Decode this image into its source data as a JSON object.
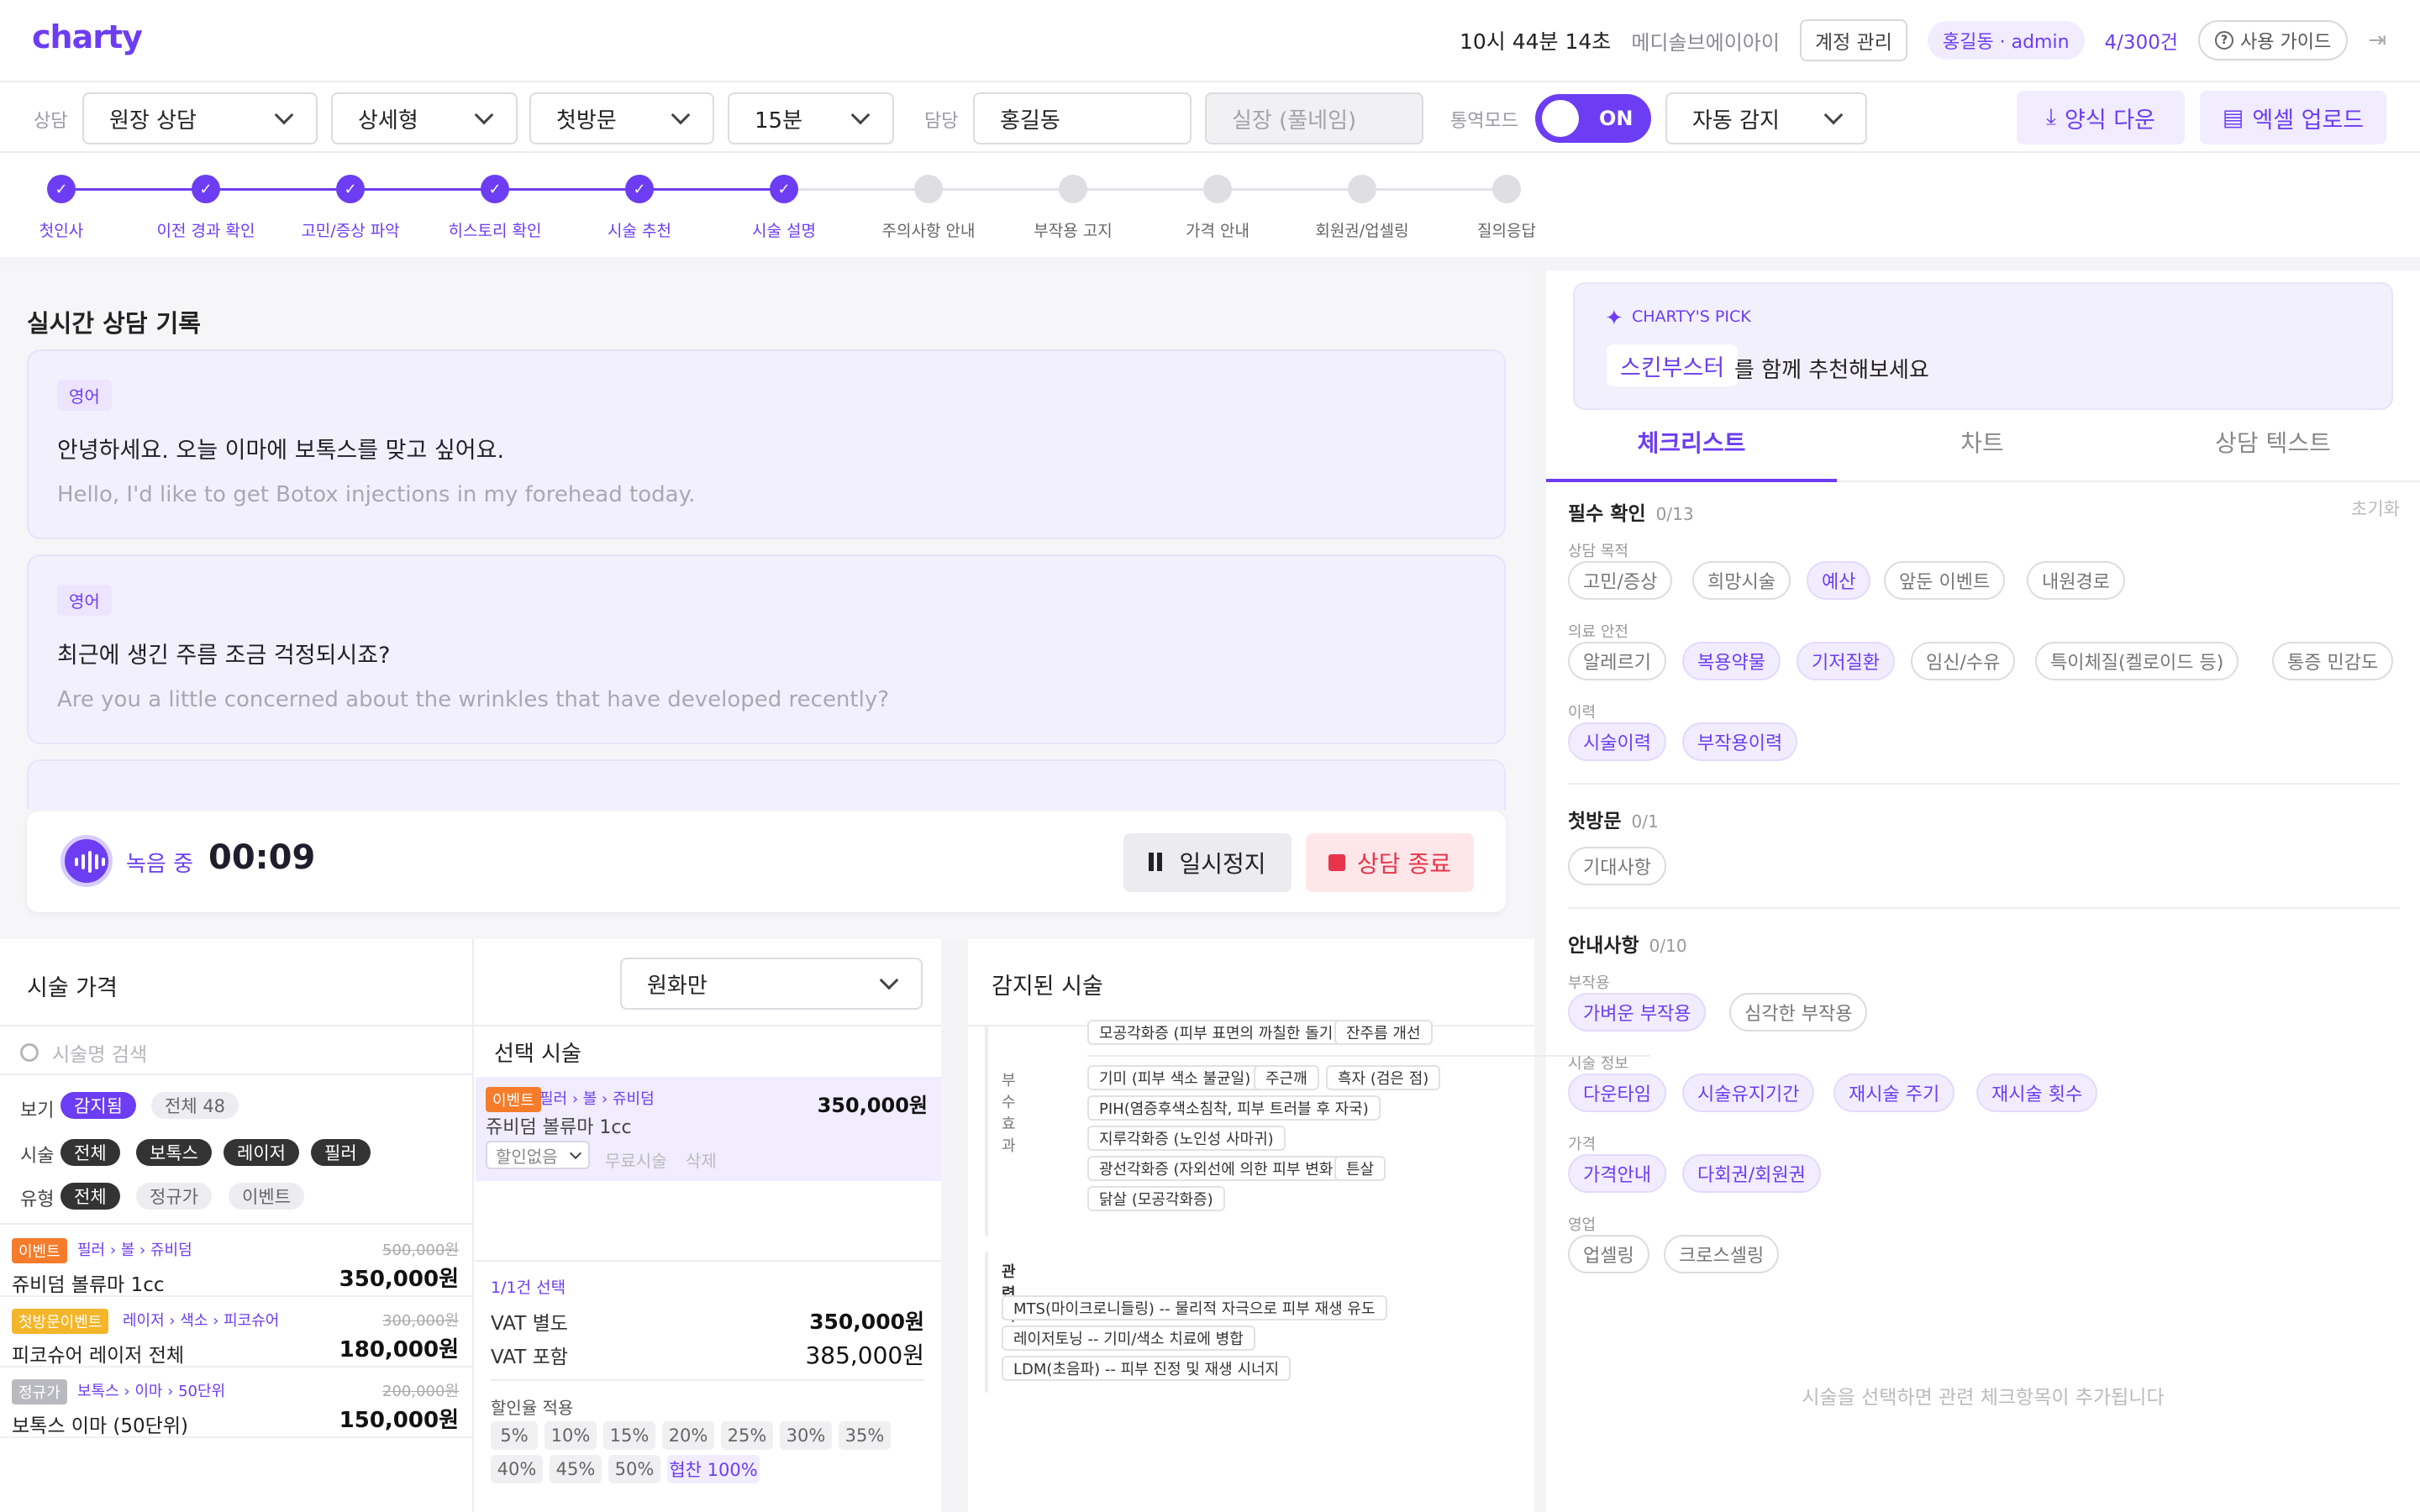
{
  "header": {
    "logo": "charty",
    "time": "10시 44분 14초",
    "org": "메디솔브에이아이",
    "account_btn": "계정 관리",
    "user": "홍길동 · admin",
    "count": "4/300건",
    "guide": "사용 가이드"
  },
  "toolbar": {
    "consult_label": "상담",
    "consult_type": "원장 상담",
    "detail": "상세형",
    "visit": "첫방문",
    "duration": "15분",
    "owner_label": "담당",
    "owner": "홍길동",
    "staff_placeholder": "실장 (풀네임)",
    "interp_label": "통역모드",
    "toggle": "ON",
    "detect": "자동 감지",
    "download": "양식 다운",
    "upload": "엑셀 업로드"
  },
  "steps": [
    {
      "label": "첫인사",
      "done": true
    },
    {
      "label": "이전 경과 확인",
      "done": true
    },
    {
      "label": "고민/증상 파악",
      "done": true
    },
    {
      "label": "히스토리 확인",
      "done": true
    },
    {
      "label": "시술 추천",
      "done": true
    },
    {
      "label": "시술 설명",
      "done": true
    },
    {
      "label": "주의사항 안내",
      "done": false
    },
    {
      "label": "부작용 고지",
      "done": false
    },
    {
      "label": "가격 안내",
      "done": false
    },
    {
      "label": "회원권/업셀링",
      "done": false
    },
    {
      "label": "질의응답",
      "done": false
    }
  ],
  "transcript": {
    "title": "실시간 상담 기록",
    "items": [
      {
        "lang": "영어",
        "ko": "안녕하세요. 오늘 이마에 보톡스를 맞고 싶어요.",
        "en": "Hello, I'd like to get Botox injections in my forehead today."
      },
      {
        "lang": "영어",
        "ko": "최근에 생긴 주름 조금 걱정되시죠?",
        "en": "Are you a little concerned about the wrinkles that have developed recently?"
      }
    ]
  },
  "recording": {
    "status": "녹음 중",
    "timer": "00:09",
    "pause": "일시정지",
    "stop": "상담 종료"
  },
  "price": {
    "title": "시술 가격",
    "currency": "원화만",
    "search_placeholder": "시술명 검색",
    "view_label": "보기",
    "view_chips": [
      "감지됨",
      "전체 48"
    ],
    "proc_label": "시술",
    "proc_chips": [
      "전체",
      "보톡스",
      "레이저",
      "필러"
    ],
    "type_label": "유형",
    "type_chips": [
      "전체",
      "정규가",
      "이벤트"
    ],
    "items": [
      {
        "badge": "이벤트",
        "badge_color": "#f57c2b",
        "cat": "필러 › 볼 › 쥬비덤",
        "name": "쥬비덤 볼류마 1cc",
        "orig": "500,000원",
        "price": "350,000원"
      },
      {
        "badge": "첫방문이벤트",
        "badge_color": "#f3b62a",
        "cat": "레이저 › 색소 › 피코슈어",
        "name": "피코슈어 레이저 전체",
        "orig": "300,000원",
        "price": "180,000원"
      },
      {
        "badge": "정규가",
        "badge_color": "#b9b9c0",
        "cat": "보톡스 › 이마 › 50단위",
        "name": "보톡스 이마 (50단위)",
        "orig": "200,000원",
        "price": "150,000원"
      }
    ]
  },
  "selected": {
    "title": "선택 시술",
    "badge": "이벤트",
    "cat": "필러 › 볼 › 쥬비덤",
    "name": "쥬비덤 볼류마 1cc",
    "price": "350,000원",
    "discount": "할인없음",
    "free": "무료시술",
    "delete": "삭제",
    "count": "1/1건 선택",
    "vat_ex_label": "VAT 별도",
    "vat_ex": "350,000원",
    "vat_in_label": "VAT 포함",
    "vat_in": "385,000원",
    "disc_label": "할인율 적용",
    "pcts": [
      "5%",
      "10%",
      "15%",
      "20%",
      "25%",
      "30%",
      "35%",
      "40%",
      "45%",
      "50%",
      "협찬 100%"
    ]
  },
  "detected": {
    "title": "감지된 시술",
    "top_tags": [
      "모공각화증 (피부 표면의 까칠한 돌기)",
      "잔주름 개선"
    ],
    "side_label": "부수 효과",
    "side_tags": [
      "기미 (피부 색소 불균일)",
      "주근깨",
      "흑자 (검은 점)",
      "PIH(염증후색소침착, 피부 트러블 후 자국)",
      "지루각화증 (노인성 사마귀)",
      "광선각화증 (자외선에 의한 피부 변화)",
      "튼살",
      "닭살 (모공각화증)"
    ],
    "related_label": "관련 시술",
    "related": [
      "MTS(마이크로니들링) -- 물리적 자극으로 피부 재생 유도",
      "레이저토닝 -- 기미/색소 치료에 병합",
      "LDM(초음파) -- 피부 진정 및 재생 시너지"
    ]
  },
  "pick": {
    "label": "CHARTY'S PICK",
    "chip": "스킨부스터",
    "text": "를 함께 추천해보세요"
  },
  "tabs": [
    "체크리스트",
    "차트",
    "상담 텍스트"
  ],
  "checklist": {
    "reset": "초기화",
    "groups": [
      {
        "title": "필수 확인",
        "count": "0/13",
        "subs": [
          {
            "label": "상담 목적",
            "chips": [
              [
                "고민/증상",
                false
              ],
              [
                "희망시술",
                false
              ],
              [
                "예산",
                true
              ],
              [
                "앞둔 이벤트",
                false
              ],
              [
                "내원경로",
                false
              ]
            ]
          },
          {
            "label": "의료 안전",
            "chips": [
              [
                "알레르기",
                false
              ],
              [
                "복용약물",
                true
              ],
              [
                "기저질환",
                true
              ],
              [
                "임신/수유",
                false
              ],
              [
                "특이체질(켈로이드 등)",
                false
              ],
              [
                "통증 민감도",
                false
              ]
            ]
          },
          {
            "label": "이력",
            "chips": [
              [
                "시술이력",
                true
              ],
              [
                "부작용이력",
                true
              ]
            ]
          }
        ]
      },
      {
        "title": "첫방문",
        "count": "0/1",
        "subs": [
          {
            "label": "",
            "chips": [
              [
                "기대사항",
                false
              ]
            ]
          }
        ]
      },
      {
        "title": "안내사항",
        "count": "0/10",
        "subs": [
          {
            "label": "부작용",
            "chips": [
              [
                "가벼운 부작용",
                true
              ],
              [
                "심각한 부작용",
                false
              ]
            ]
          },
          {
            "label": "시술 정보",
            "chips": [
              [
                "다운타임",
                true
              ],
              [
                "시술유지기간",
                true
              ],
              [
                "재시술 주기",
                true
              ],
              [
                "재시술 횟수",
                true
              ]
            ]
          },
          {
            "label": "가격",
            "chips": [
              [
                "가격안내",
                true
              ],
              [
                "다회권/회원권",
                true
              ]
            ]
          },
          {
            "label": "영업",
            "chips": [
              [
                "업셀링",
                false
              ],
              [
                "크로스셀링",
                false
              ]
            ]
          }
        ]
      }
    ],
    "footer": "시술을 선택하면 관련 체크항목이 추가됩니다"
  }
}
